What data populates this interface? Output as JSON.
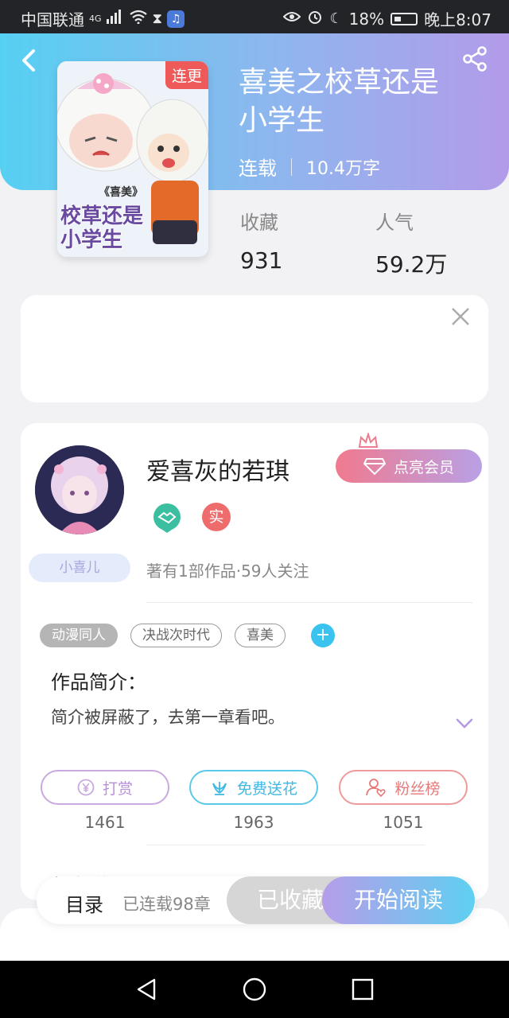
{
  "status_bar": {
    "carrier": "中国联通",
    "network": "4G",
    "battery": "18%",
    "time": "晚上8:07"
  },
  "book": {
    "title_line1": "喜美之校草还是",
    "title_line2": "小学生",
    "status": "连载",
    "word_count": "10.4万字",
    "cover_badge": "连更",
    "cover_text_top": "《喜美》",
    "cover_text_main": "校草还是小学生",
    "favorites_label": "收藏",
    "favorites_value": "931",
    "popularity_label": "人气",
    "popularity_value": "59.2万"
  },
  "author": {
    "name": "爱喜灰的若琪",
    "vip_label": "点亮会员",
    "verified_badge": "实",
    "level_tag": "小喜儿",
    "meta": "著有1部作品·59人关注"
  },
  "tags": [
    "动漫同人",
    "决战次时代",
    "喜美"
  ],
  "intro": {
    "title": "作品简介：",
    "text": "简介被屏蔽了，去第一章看吧。"
  },
  "actions": [
    {
      "label": "打赏",
      "count": "1461"
    },
    {
      "label": "免费送花",
      "count": "1963"
    },
    {
      "label": "粉丝榜",
      "count": "1051"
    }
  ],
  "partial_section": "作者说",
  "bottom": {
    "toc_label": "目录",
    "toc_count": "已连载98章",
    "fav_label": "已收藏",
    "read_label": "开始阅读"
  },
  "colors": {
    "header_gradient_start": "#56d0f2",
    "header_gradient_end": "#b39bea",
    "accent_red": "#ee5a5a",
    "accent_blue": "#3ac3ef"
  }
}
